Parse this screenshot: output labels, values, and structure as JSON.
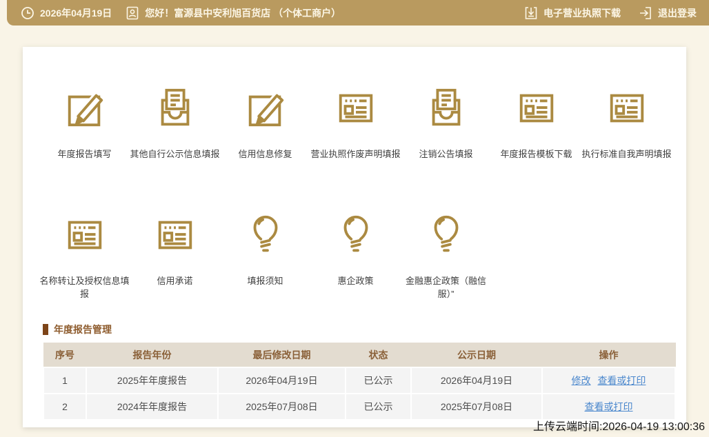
{
  "topbar": {
    "date": "2026年04月19日",
    "greeting": "您好！富源县中安利旭百货店 （个体工商户）",
    "license_download_label": "电子营业执照下载",
    "logout_label": "退出登录"
  },
  "features": {
    "row1": [
      {
        "label": "年度报告填写",
        "icon": "edit-square-icon"
      },
      {
        "label": "其他自行公示信息填报",
        "icon": "inbox-doc-icon"
      },
      {
        "label": "信用信息修复",
        "icon": "edit-square-icon"
      },
      {
        "label": "营业执照作废声明填报",
        "icon": "browser-icon"
      },
      {
        "label": "注销公告填报",
        "icon": "inbox-doc-icon"
      },
      {
        "label": "年度报告模板下载",
        "icon": "browser-icon"
      },
      {
        "label": "执行标准自我声明填报",
        "icon": "browser-icon"
      }
    ],
    "row2": [
      {
        "label": "名称转让及授权信息填报",
        "icon": "browser-icon"
      },
      {
        "label": "信用承诺",
        "icon": "browser-icon"
      },
      {
        "label": "填报须知",
        "icon": "lightbulb-icon"
      },
      {
        "label": "惠企政策",
        "icon": "lightbulb-icon"
      },
      {
        "label": "金融惠企政策（融信服）”",
        "icon": "lightbulb-icon"
      }
    ]
  },
  "report_section": {
    "title": "年度报告管理",
    "table": {
      "headers": [
        "序号",
        "报告年份",
        "最后修改日期",
        "状态",
        "公示日期",
        "操作"
      ],
      "rows": [
        {
          "no": "1",
          "year": "2025年年度报告",
          "modified": "2026年04月19日",
          "status": "已公示",
          "published": "2026年04月19日",
          "actions": [
            "修改",
            "查看或打印"
          ]
        },
        {
          "no": "2",
          "year": "2024年年度报告",
          "modified": "2025年07月08日",
          "status": "已公示",
          "published": "2025年07月08日",
          "actions": [
            "查看或打印"
          ]
        }
      ]
    }
  },
  "footer": {
    "upload_time": "上传云端时间:2026-04-19 13:00:36"
  },
  "colors": {
    "topbar_bg": "#b99a5f",
    "icon_gold": "#ab8a41",
    "link_blue": "#4a87cd",
    "table_header_bg": "#e3dcd0",
    "section_brown": "#8e5c2e",
    "page_bg": "#f9f4e7"
  }
}
